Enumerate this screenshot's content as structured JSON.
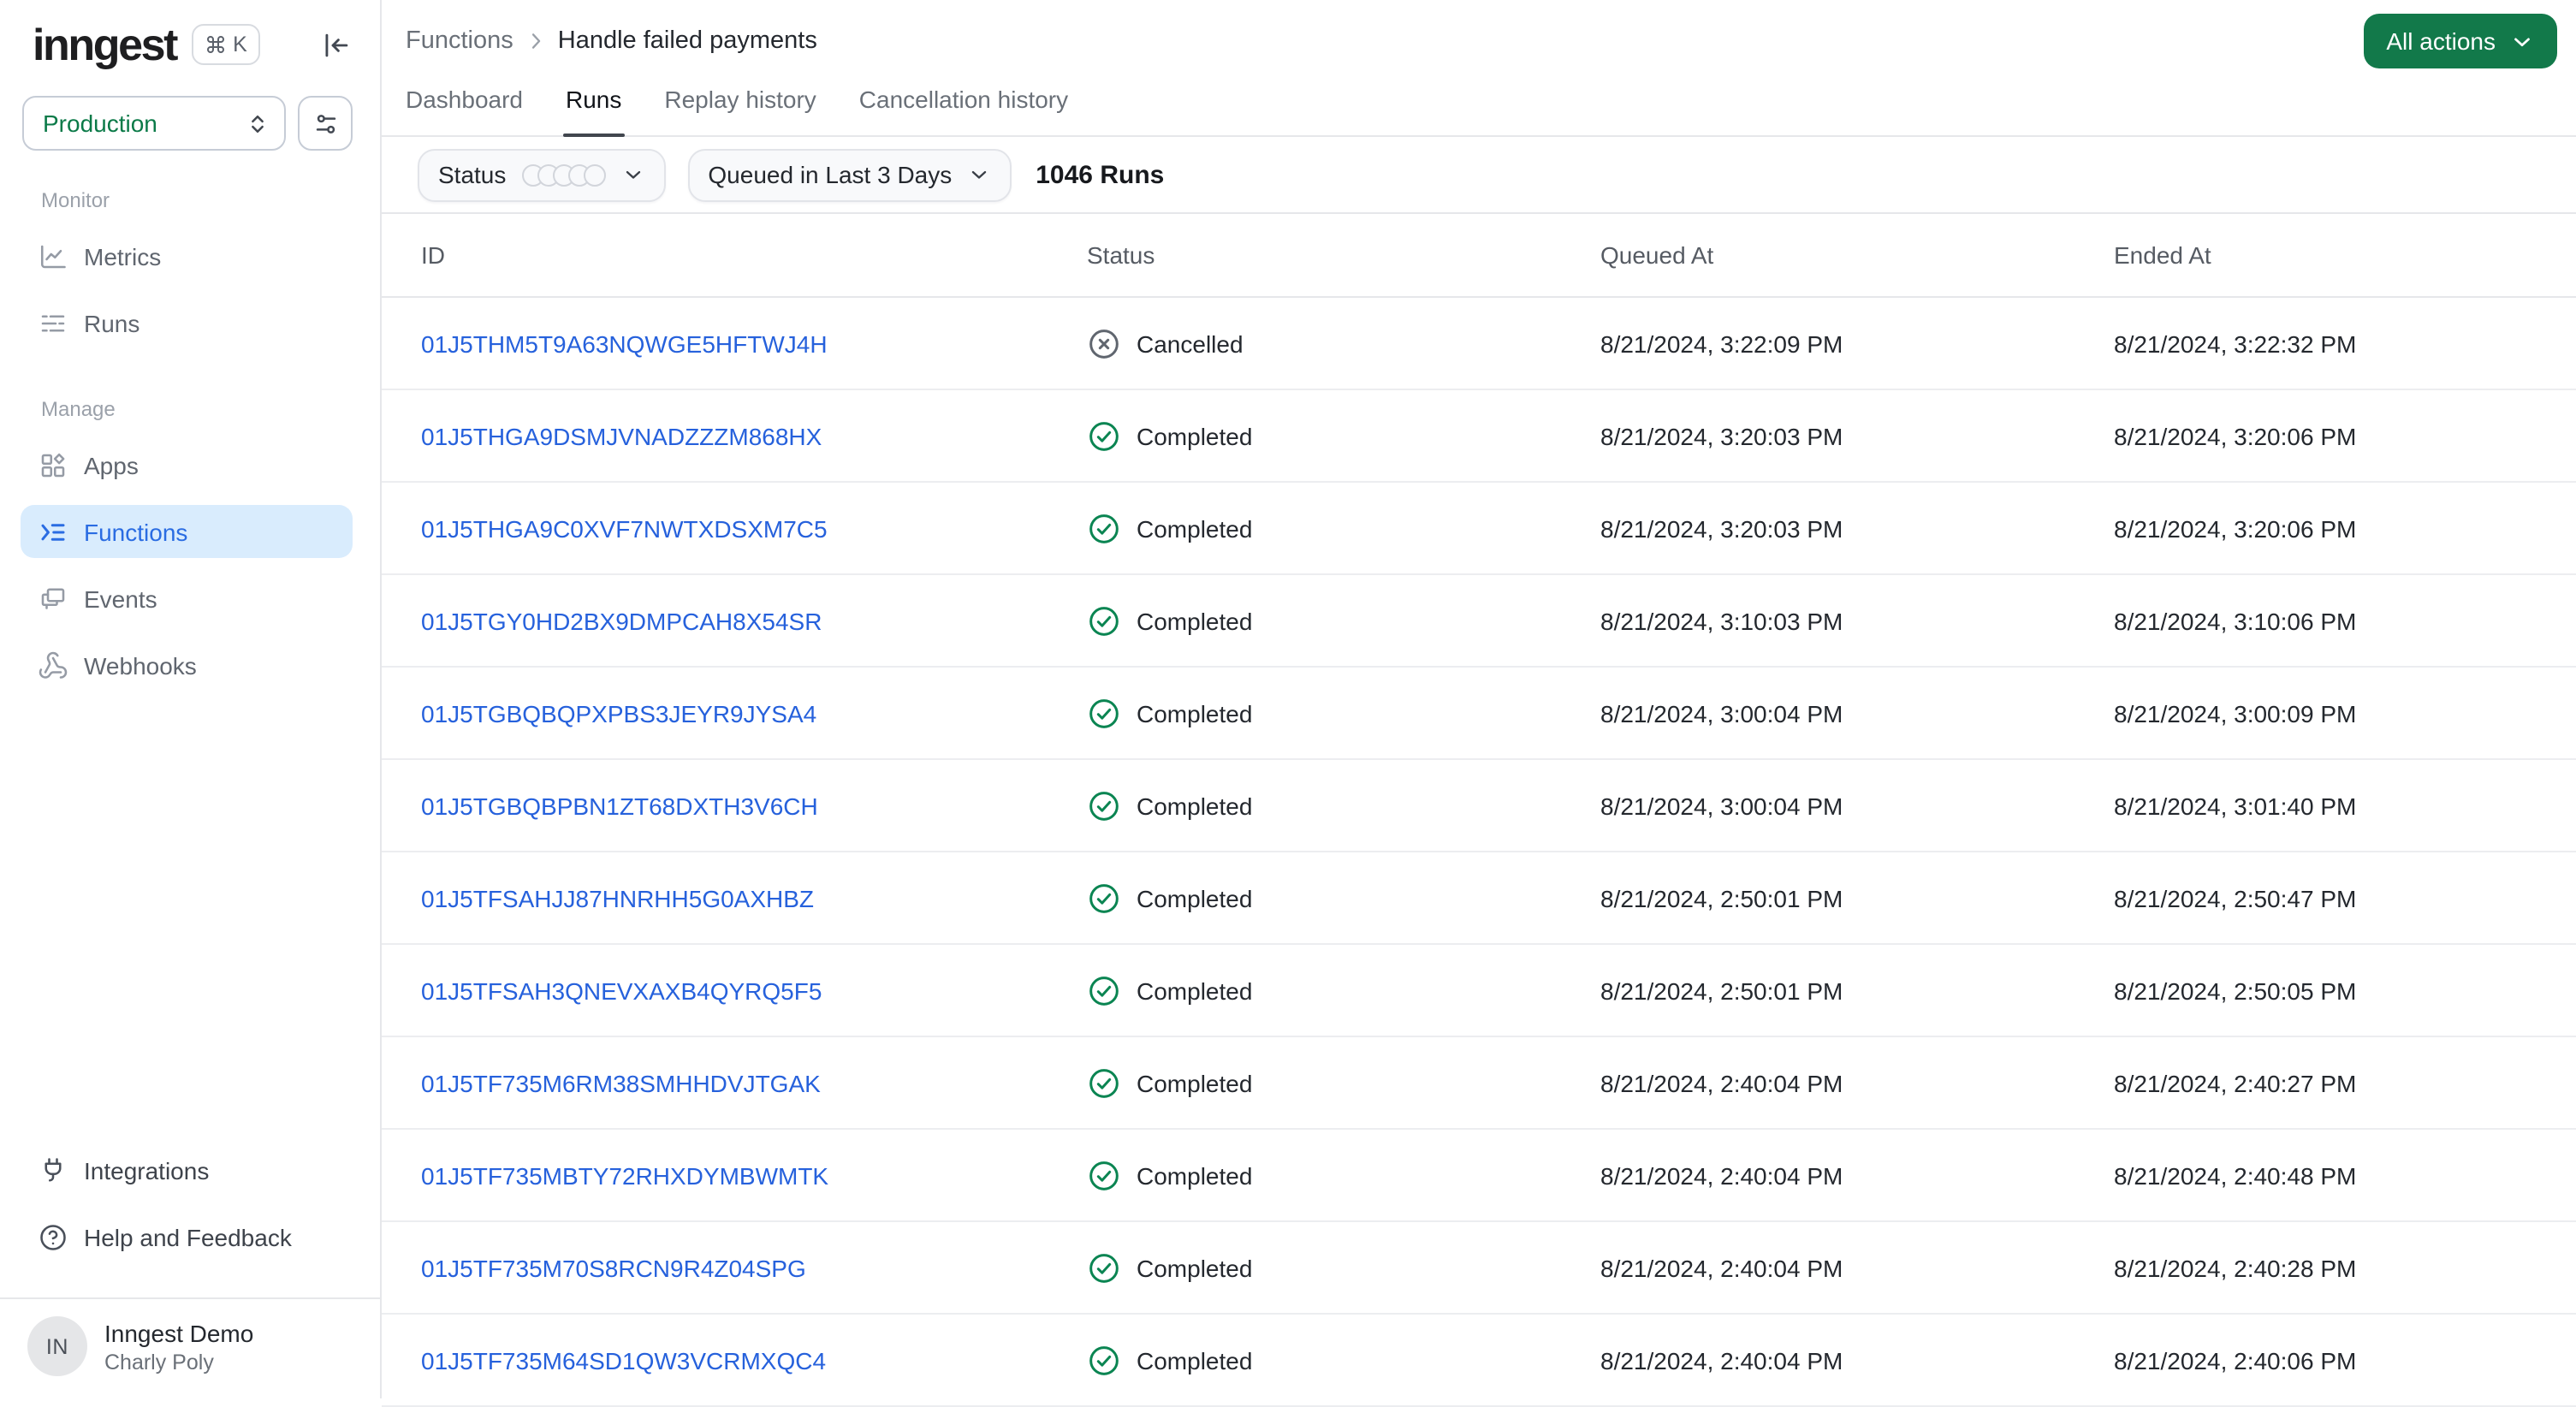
{
  "colors": {
    "accent_green": "#12794A",
    "environment_green": "#0B7A48",
    "link_blue": "#2661DC",
    "active_nav_bg": "#D9ECFD",
    "active_nav_text": "#2A6CE2",
    "completed_green": "#0B8552",
    "cancelled_gray": "#60666F",
    "border_gray": "#E6E7EA"
  },
  "sidebar": {
    "logo": "inngest",
    "shortcut_key": "K",
    "environment": "Production",
    "sections": [
      {
        "label": "Monitor",
        "items": [
          {
            "label": "Metrics"
          },
          {
            "label": "Runs"
          }
        ]
      },
      {
        "label": "Manage",
        "items": [
          {
            "label": "Apps"
          },
          {
            "label": "Functions",
            "active": true
          },
          {
            "label": "Events"
          },
          {
            "label": "Webhooks"
          }
        ]
      }
    ],
    "footer_items": [
      {
        "label": "Integrations"
      },
      {
        "label": "Help and Feedback"
      }
    ],
    "user": {
      "initials": "IN",
      "org": "Inngest Demo",
      "name": "Charly Poly"
    }
  },
  "header": {
    "breadcrumb": {
      "parent": "Functions",
      "current": "Handle failed payments"
    },
    "action_button": "All actions"
  },
  "tabs": [
    {
      "label": "Dashboard"
    },
    {
      "label": "Runs",
      "active": true
    },
    {
      "label": "Replay history"
    },
    {
      "label": "Cancellation history"
    }
  ],
  "filters": {
    "status": "Status",
    "time_range": "Queued in Last 3 Days",
    "runs_count": "1046 Runs"
  },
  "table": {
    "columns": [
      "ID",
      "Status",
      "Queued At",
      "Ended At"
    ],
    "rows": [
      {
        "id": "01J5THM5T9A63NQWGE5HFTWJ4H",
        "status": "Cancelled",
        "queued_at": "8/21/2024, 3:22:09 PM",
        "ended_at": "8/21/2024, 3:22:32 PM"
      },
      {
        "id": "01J5THGA9DSMJVNADZZZM868HX",
        "status": "Completed",
        "queued_at": "8/21/2024, 3:20:03 PM",
        "ended_at": "8/21/2024, 3:20:06 PM"
      },
      {
        "id": "01J5THGA9C0XVF7NWTXDSXM7C5",
        "status": "Completed",
        "queued_at": "8/21/2024, 3:20:03 PM",
        "ended_at": "8/21/2024, 3:20:06 PM"
      },
      {
        "id": "01J5TGY0HD2BX9DMPCAH8X54SR",
        "status": "Completed",
        "queued_at": "8/21/2024, 3:10:03 PM",
        "ended_at": "8/21/2024, 3:10:06 PM"
      },
      {
        "id": "01J5TGBQBQPXPBS3JEYR9JYSA4",
        "status": "Completed",
        "queued_at": "8/21/2024, 3:00:04 PM",
        "ended_at": "8/21/2024, 3:00:09 PM"
      },
      {
        "id": "01J5TGBQBPBN1ZT68DXTH3V6CH",
        "status": "Completed",
        "queued_at": "8/21/2024, 3:00:04 PM",
        "ended_at": "8/21/2024, 3:01:40 PM"
      },
      {
        "id": "01J5TFSAHJJ87HNRHH5G0AXHBZ",
        "status": "Completed",
        "queued_at": "8/21/2024, 2:50:01 PM",
        "ended_at": "8/21/2024, 2:50:47 PM"
      },
      {
        "id": "01J5TFSAH3QNEVXAXB4QYRQ5F5",
        "status": "Completed",
        "queued_at": "8/21/2024, 2:50:01 PM",
        "ended_at": "8/21/2024, 2:50:05 PM"
      },
      {
        "id": "01J5TF735M6RM38SMHHDVJTGAK",
        "status": "Completed",
        "queued_at": "8/21/2024, 2:40:04 PM",
        "ended_at": "8/21/2024, 2:40:27 PM"
      },
      {
        "id": "01J5TF735MBTY72RHXDYMBWMTK",
        "status": "Completed",
        "queued_at": "8/21/2024, 2:40:04 PM",
        "ended_at": "8/21/2024, 2:40:48 PM"
      },
      {
        "id": "01J5TF735M70S8RCN9R4Z04SPG",
        "status": "Completed",
        "queued_at": "8/21/2024, 2:40:04 PM",
        "ended_at": "8/21/2024, 2:40:28 PM"
      },
      {
        "id": "01J5TF735M64SD1QW3VCRMXQC4",
        "status": "Completed",
        "queued_at": "8/21/2024, 2:40:04 PM",
        "ended_at": "8/21/2024, 2:40:06 PM"
      }
    ]
  }
}
